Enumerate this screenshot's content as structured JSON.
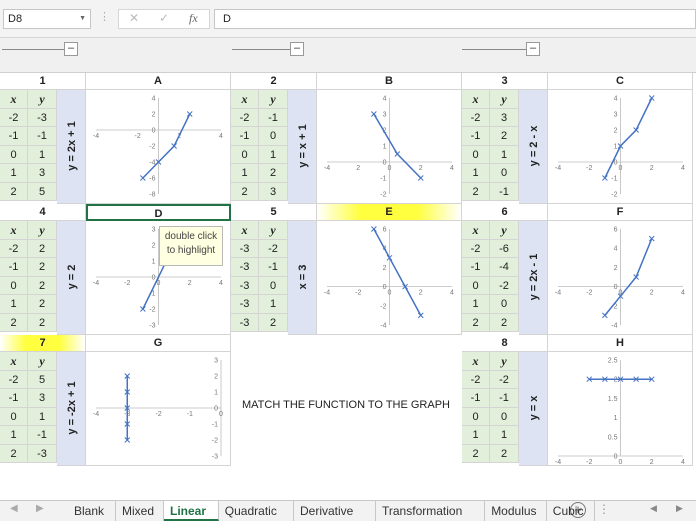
{
  "formula_bar": {
    "name_box": "D8",
    "fx_label": "fx",
    "formula": "D"
  },
  "blocks": [
    {
      "num": "1",
      "letter": "A",
      "xs": [
        "-2",
        "-1",
        "0",
        "1",
        "2"
      ],
      "ys": [
        "-3",
        "-1",
        "1",
        "3",
        "5"
      ],
      "func": "y = 2x + 1"
    },
    {
      "num": "2",
      "letter": "B",
      "xs": [
        "-2",
        "-1",
        "0",
        "1",
        "2"
      ],
      "ys": [
        "-1",
        "0",
        "1",
        "2",
        "3"
      ],
      "func": "y = x + 1"
    },
    {
      "num": "3",
      "letter": "C",
      "xs": [
        "-2",
        "-1",
        "0",
        "1",
        "2"
      ],
      "ys": [
        "3",
        "2",
        "1",
        "0",
        "-1"
      ],
      "func": "y = 2 - x"
    },
    {
      "num": "4",
      "letter": "D",
      "xs": [
        "-2",
        "-1",
        "0",
        "1",
        "2"
      ],
      "ys": [
        "2",
        "2",
        "2",
        "2",
        "2"
      ],
      "func": "y = 2"
    },
    {
      "num": "5",
      "letter": "E",
      "xs": [
        "-3",
        "-3",
        "-3",
        "-3",
        "-3"
      ],
      "ys": [
        "-2",
        "-1",
        "0",
        "1",
        "2"
      ],
      "func": "x = 3"
    },
    {
      "num": "6",
      "letter": "F",
      "xs": [
        "-2",
        "-1",
        "0",
        "1",
        "2"
      ],
      "ys": [
        "-6",
        "-4",
        "-2",
        "0",
        "2"
      ],
      "func": "y = 2x - 1"
    },
    {
      "num": "7",
      "letter": "G",
      "xs": [
        "-2",
        "-1",
        "0",
        "1",
        "2"
      ],
      "ys": [
        "5",
        "3",
        "1",
        "-1",
        "-3"
      ],
      "func": "y = -2x + 1"
    },
    {
      "num": "8",
      "letter": "H",
      "xs": [
        "-2",
        "-1",
        "0",
        "1",
        "2"
      ],
      "ys": [
        "-2",
        "-1",
        "0",
        "1",
        "2"
      ],
      "func": "y = x"
    }
  ],
  "col_x": "x",
  "col_y": "y",
  "note": {
    "line1": "double click",
    "line2": "to highlight"
  },
  "center_message": "MATCH THE FUNCTION TO THE GRAPH",
  "tabs": [
    "Blank",
    "Mixed",
    "Linear",
    "Quadratic",
    "Derivative",
    "Transformation",
    "Modulus",
    "Cubic"
  ],
  "active_tab": "Linear",
  "chart_data": [
    {
      "type": "line",
      "letter": "A",
      "x": [
        -1,
        0,
        1,
        2
      ],
      "y": [
        -6,
        -4,
        -2,
        2
      ],
      "xlim": [
        -4,
        4
      ],
      "ylim": [
        -8,
        4
      ],
      "xticks": [
        "-4",
        "-2",
        "2",
        "4"
      ],
      "yticks": [
        "4",
        "2",
        "0",
        "-2",
        "-4",
        "-6",
        "-8"
      ]
    },
    {
      "type": "line",
      "letter": "B",
      "x": [
        -1,
        0.5,
        2
      ],
      "y": [
        3,
        0.5,
        -1
      ],
      "xlim": [
        -4,
        4
      ],
      "ylim": [
        -2,
        4
      ],
      "xticks": [
        "-4",
        "2",
        "0",
        "2",
        "4"
      ],
      "yticks": [
        "4",
        "3",
        "2",
        "1",
        "0",
        "-1",
        "-2"
      ]
    },
    {
      "type": "line",
      "letter": "C",
      "x": [
        -1,
        0,
        1,
        2
      ],
      "y": [
        -1,
        1,
        2,
        4
      ],
      "xlim": [
        -4,
        4
      ],
      "ylim": [
        -2,
        4
      ],
      "xticks": [
        "-4",
        "-2",
        "0",
        "2",
        "4"
      ],
      "yticks": [
        "4",
        "3",
        "2",
        "1",
        "0",
        "-1",
        "-2"
      ]
    },
    {
      "type": "line",
      "letter": "D",
      "x": [
        -1,
        1
      ],
      "y": [
        -2,
        2
      ],
      "xlim": [
        -4,
        4
      ],
      "ylim": [
        -3,
        3
      ],
      "xticks": [
        "-4",
        "-2",
        "0",
        "2",
        "4"
      ],
      "yticks": [
        "3",
        "2",
        "1",
        "0",
        "-1",
        "-2",
        "-3"
      ]
    },
    {
      "type": "line",
      "letter": "E",
      "x": [
        -1,
        0,
        1,
        2
      ],
      "y": [
        6,
        3,
        0,
        -3
      ],
      "xlim": [
        -4,
        4
      ],
      "ylim": [
        -4,
        6
      ],
      "xticks": [
        "-4",
        "-2",
        "0",
        "2",
        "4"
      ],
      "yticks": [
        "6",
        "4",
        "2",
        "0",
        "-2",
        "-4"
      ]
    },
    {
      "type": "line",
      "letter": "F",
      "x": [
        -1,
        0,
        1,
        2
      ],
      "y": [
        -3,
        -1,
        1,
        5
      ],
      "xlim": [
        -4,
        4
      ],
      "ylim": [
        -4,
        6
      ],
      "xticks": [
        "-4",
        "-2",
        "0",
        "2",
        "4"
      ],
      "yticks": [
        "6",
        "4",
        "2",
        "0",
        "-2",
        "-4"
      ]
    },
    {
      "type": "line",
      "letter": "G",
      "x": [
        -3,
        -3,
        -3,
        -3,
        -3
      ],
      "y": [
        -2,
        -1,
        0,
        1,
        2
      ],
      "xlim": [
        -4,
        0
      ],
      "ylim": [
        -3,
        3
      ],
      "xticks": [
        "-4",
        "-3",
        "-2",
        "-1",
        "0"
      ],
      "yticks": [
        "3",
        "2",
        "1",
        "0",
        "-1",
        "-2",
        "-3"
      ]
    },
    {
      "type": "line",
      "letter": "H",
      "x": [
        -2,
        -1,
        0,
        1,
        2
      ],
      "y": [
        2,
        2,
        2,
        2,
        2
      ],
      "xlim": [
        -4,
        4
      ],
      "ylim": [
        0,
        2.5
      ],
      "xticks": [
        "-4",
        "-2",
        "0",
        "2",
        "4"
      ],
      "yticks": [
        "2.5",
        "2",
        "1.5",
        "1",
        "0.5",
        "0"
      ]
    }
  ]
}
